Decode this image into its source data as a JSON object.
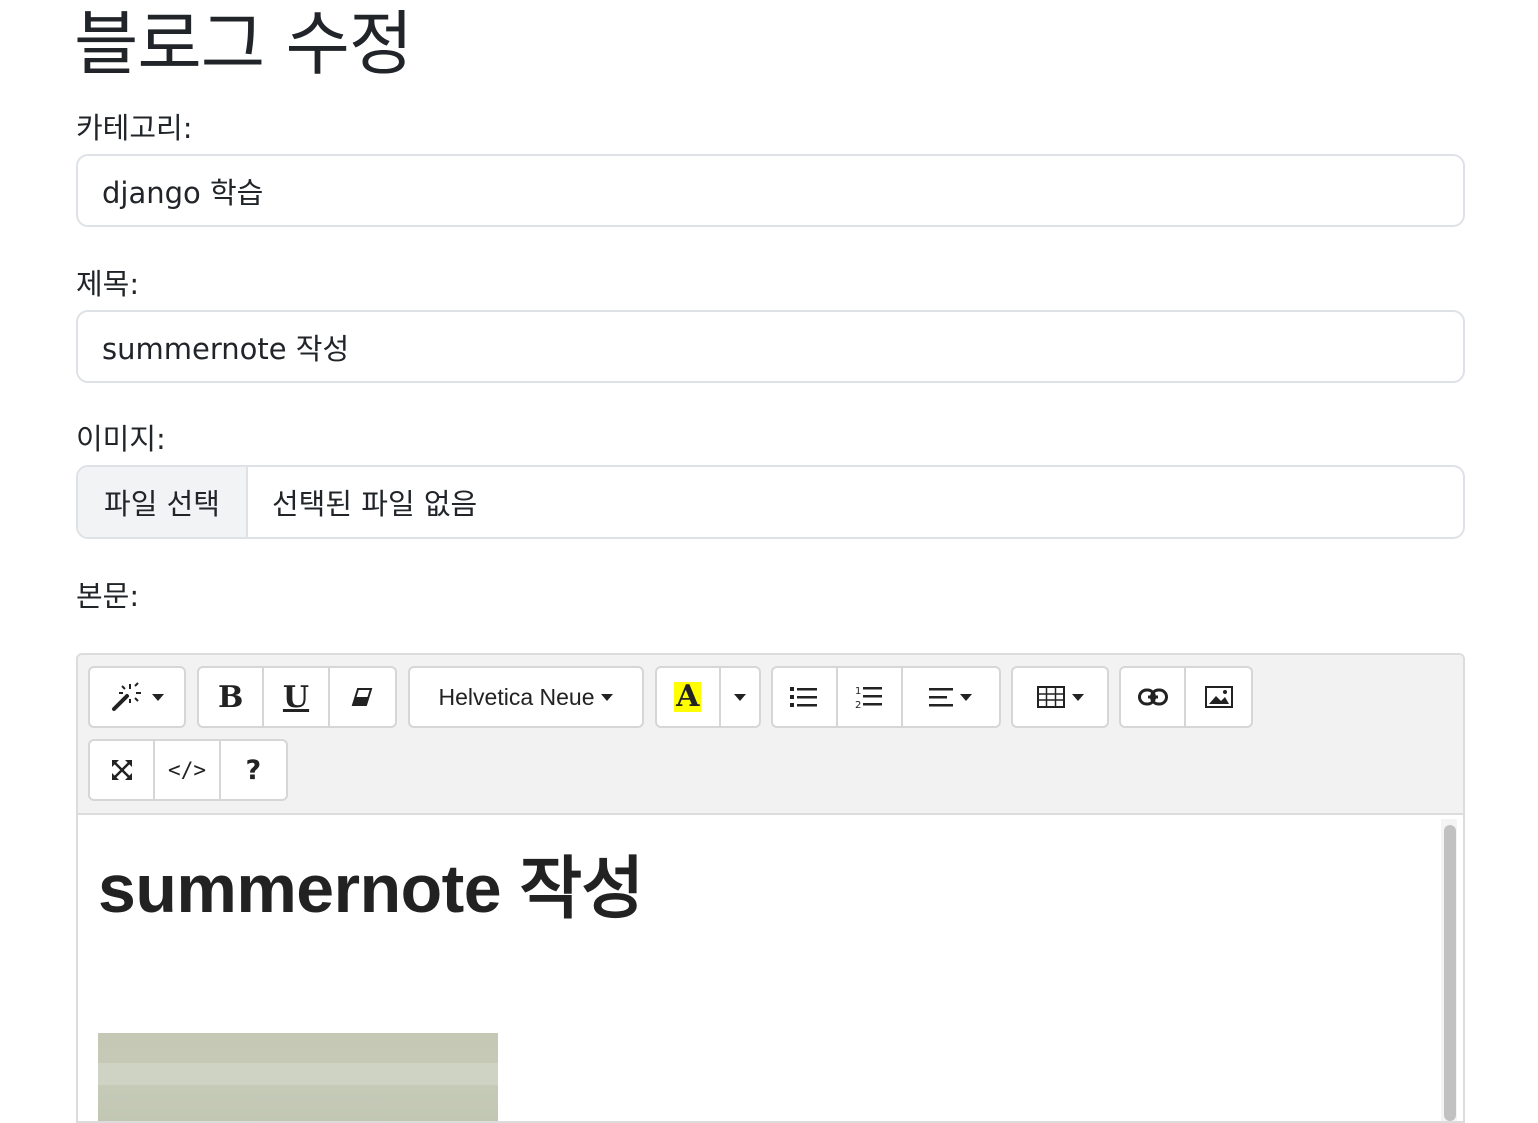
{
  "page": {
    "title": "블로그 수정"
  },
  "form": {
    "category": {
      "label": "카테고리:",
      "value": "django 학습"
    },
    "title": {
      "label": "제목:",
      "value": "summernote 작성"
    },
    "image": {
      "label": "이미지:",
      "button": "파일 선택",
      "status": "선택된 파일 없음"
    },
    "body": {
      "label": "본문:"
    }
  },
  "editor": {
    "toolbar": {
      "style_icon": "magic-wand-icon",
      "bold_label": "B",
      "underline_label": "U",
      "eraser_icon": "eraser-icon",
      "font_name": "Helvetica Neue",
      "color_label": "A",
      "highlight_color": "#ffff00",
      "ul_icon": "unordered-list-icon",
      "ol_icon": "ordered-list-icon",
      "align_icon": "align-left-icon",
      "table_icon": "table-icon",
      "link_icon": "link-icon",
      "picture_icon": "picture-icon",
      "fullscreen_icon": "fullscreen-icon",
      "codeview_label": "</>",
      "help_label": "?"
    },
    "content": {
      "heading": "summernote 작성"
    }
  }
}
